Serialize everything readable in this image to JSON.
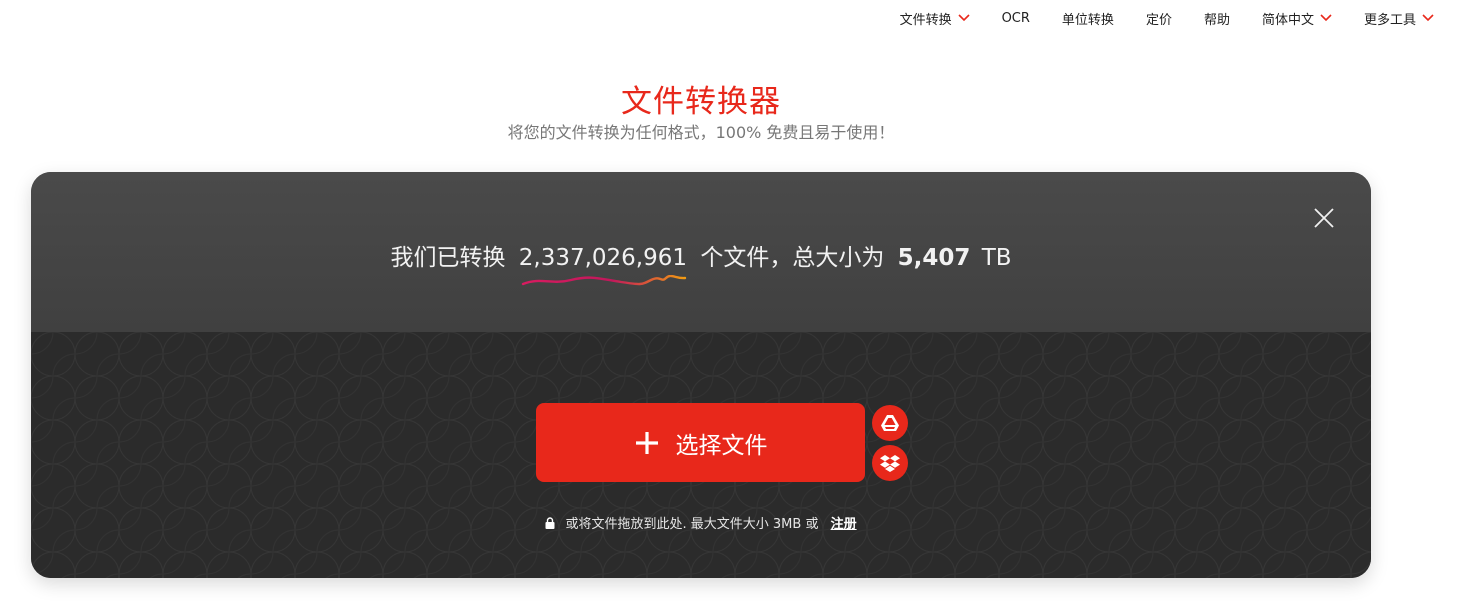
{
  "nav": {
    "items": [
      {
        "label": "文件转换",
        "dropdown": true
      },
      {
        "label": "OCR",
        "dropdown": false
      },
      {
        "label": "单位转换",
        "dropdown": false
      },
      {
        "label": "定价",
        "dropdown": false
      },
      {
        "label": "帮助",
        "dropdown": false
      },
      {
        "label": "简体中文",
        "dropdown": true
      },
      {
        "label": "更多工具",
        "dropdown": true
      }
    ]
  },
  "hero": {
    "title": "文件转换器",
    "subtitle": "将您的文件转换为任何格式，100% 免费且易于使用！"
  },
  "stats": {
    "prefix": "我们已转换",
    "count": "2,337,026,961",
    "middle": "个文件，总大小为",
    "size": "5,407",
    "unit": "TB"
  },
  "upload": {
    "choose_label": "选择文件",
    "drop_text": "或将文件拖放到此处. 最大文件大小 3MB 或",
    "signup_label": "注册"
  },
  "icons": {
    "close": "close-icon",
    "plus": "plus-icon",
    "gdrive": "google-drive-icon",
    "dropbox": "dropbox-icon",
    "lock": "lock-icon",
    "chevron": "chevron-down-icon"
  },
  "colors": {
    "accent": "#e8281b",
    "card_top": "#454545",
    "card_bottom": "#2b2b2b"
  }
}
